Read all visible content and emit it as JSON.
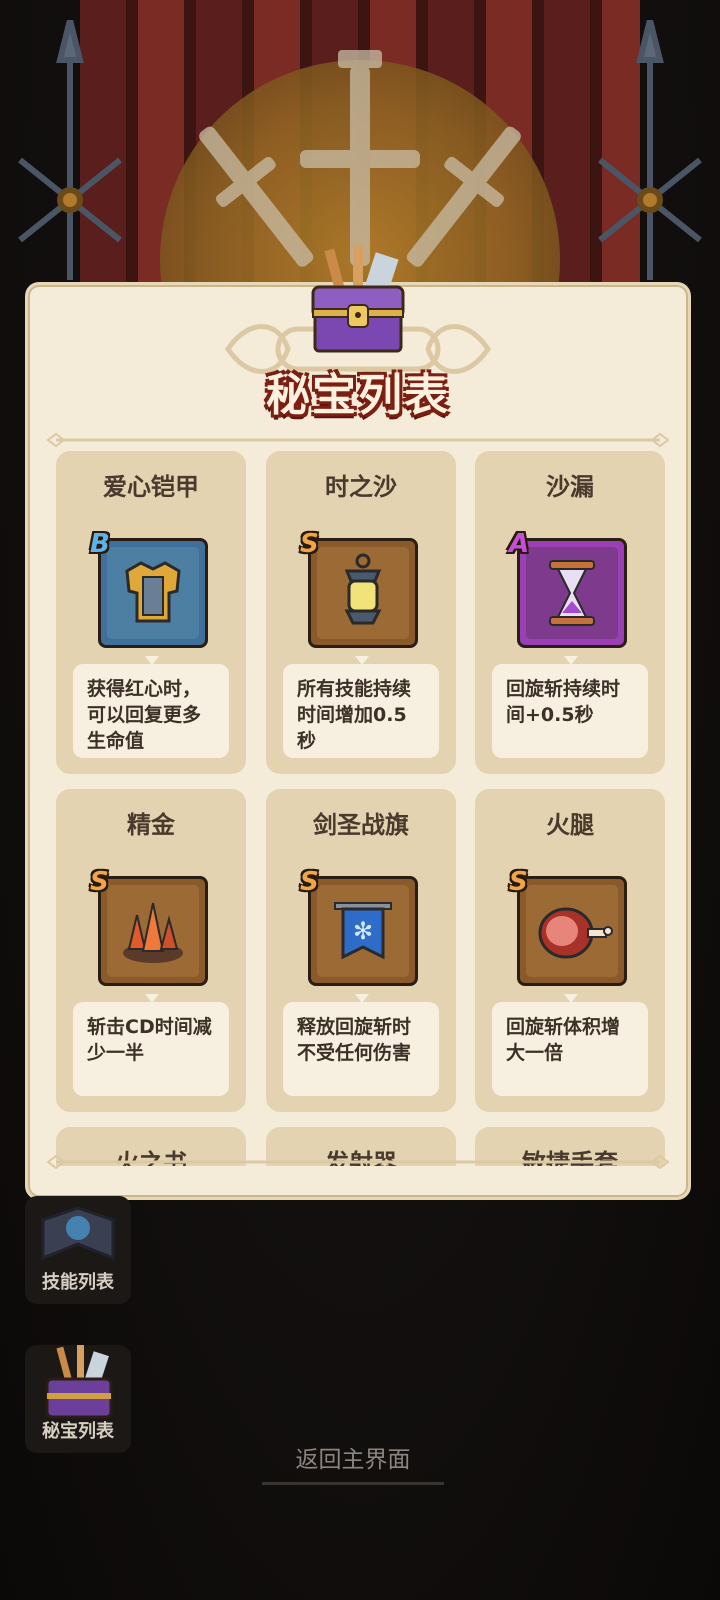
{
  "panel": {
    "title": "秘宝列表"
  },
  "treasures": [
    {
      "name": "爱心铠甲",
      "rank": "B",
      "rank_color": "#5fb3e8",
      "frame_color": "#3f6f9a",
      "inner_color": "#4d7fa3",
      "icon": "armor-icon",
      "desc": "获得红心时，可以回复更多生命值"
    },
    {
      "name": "时之沙",
      "rank": "S",
      "rank_color": "#f0a646",
      "frame_color": "#8a5a2a",
      "inner_color": "#9c6a34",
      "icon": "lantern-icon",
      "desc": "所有技能持续时间增加0.5秒"
    },
    {
      "name": "沙漏",
      "rank": "A",
      "rank_color": "#c64fd8",
      "frame_color": "#9b3fb4",
      "inner_color": "#7e3a8c",
      "icon": "hourglass-icon",
      "desc": "回旋斩持续时间+0.5秒"
    },
    {
      "name": "精金",
      "rank": "S",
      "rank_color": "#f0a646",
      "frame_color": "#8a5a2a",
      "inner_color": "#9c6a34",
      "icon": "crystal-icon",
      "desc": "斩击CD时间减少一半"
    },
    {
      "name": "剑圣战旗",
      "rank": "S",
      "rank_color": "#f0a646",
      "frame_color": "#8a5a2a",
      "inner_color": "#9c6a34",
      "icon": "banner-flag-icon",
      "desc": "释放回旋斩时不受任何伤害"
    },
    {
      "name": "火腿",
      "rank": "S",
      "rank_color": "#f0a646",
      "frame_color": "#8a5a2a",
      "inner_color": "#9c6a34",
      "icon": "ham-icon",
      "desc": "回旋斩体积增大一倍"
    },
    {
      "name": "火之书",
      "rank": "",
      "rank_color": "#f0a646",
      "frame_color": "#8a5a2a",
      "inner_color": "#9c6a34",
      "icon": "book-icon",
      "desc": ""
    },
    {
      "name": "发射器",
      "rank": "",
      "rank_color": "#f0a646",
      "frame_color": "#8a5a2a",
      "inner_color": "#9c6a34",
      "icon": "launcher-icon",
      "desc": ""
    },
    {
      "name": "敏捷手套",
      "rank": "",
      "rank_color": "#f0a646",
      "frame_color": "#8a5a2a",
      "inner_color": "#9c6a34",
      "icon": "glove-icon",
      "desc": ""
    }
  ],
  "side_buttons": {
    "skills_label": "技能列表",
    "treasures_label": "秘宝列表"
  },
  "return_label": "返回主界面"
}
